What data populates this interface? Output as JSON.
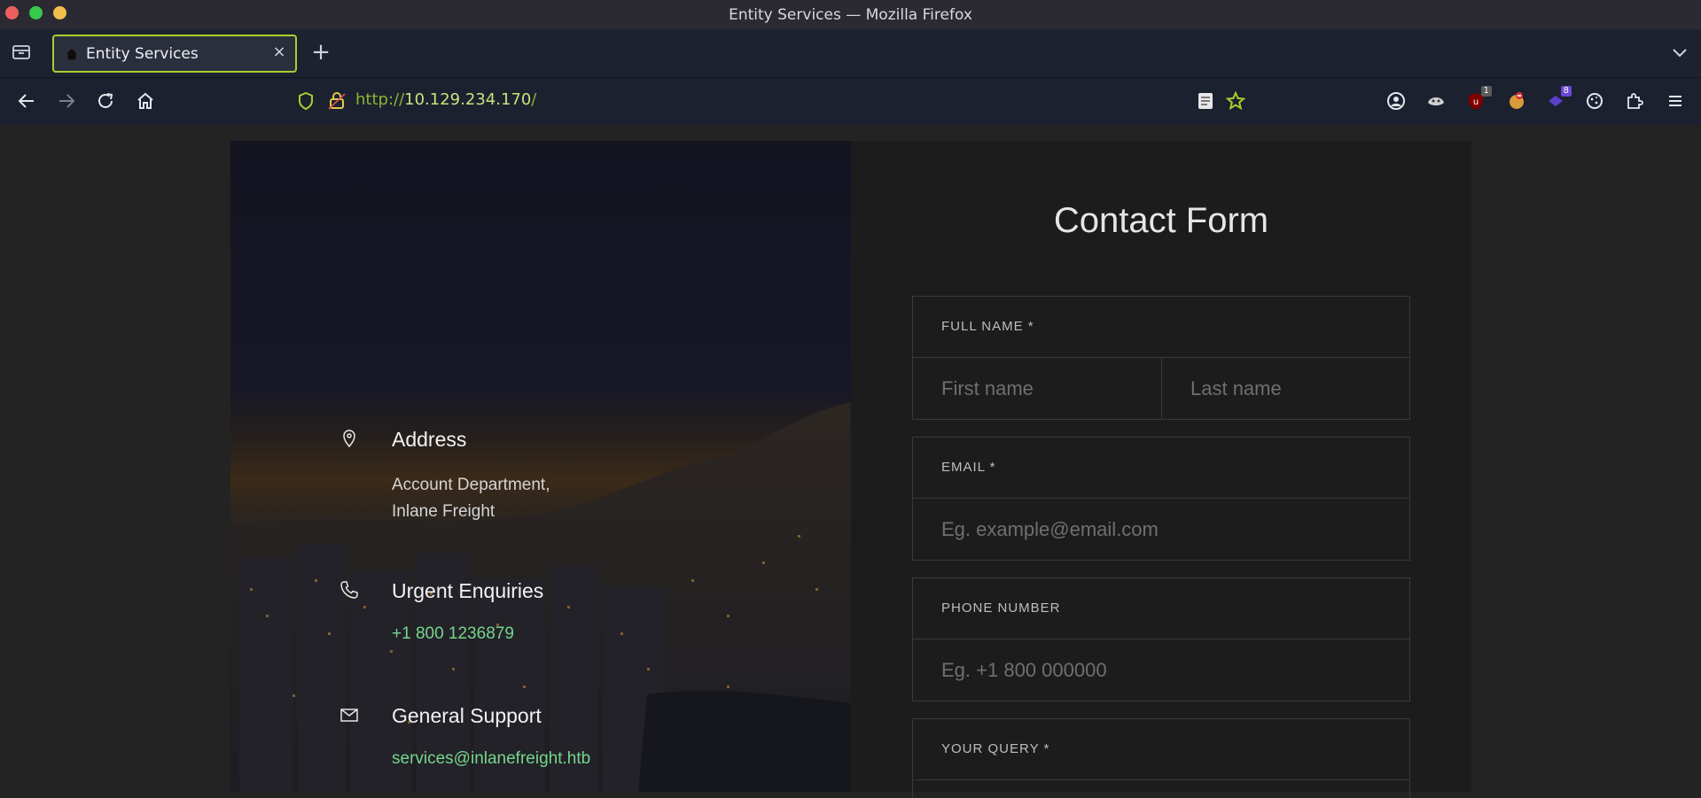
{
  "window": {
    "title": "Entity Services — Mozilla Firefox"
  },
  "tabs": [
    {
      "title": "Entity Services",
      "active": true
    }
  ],
  "navbar": {
    "url_scheme": "http://",
    "url_host": "10.129.234.170",
    "url_path": "/",
    "extension_badges": {
      "ublock": "1",
      "ext_purple": "8"
    }
  },
  "contact_info": {
    "address": {
      "title": "Address",
      "line1": "Account Department,",
      "line2": "Inlane Freight"
    },
    "urgent": {
      "title": "Urgent Enquiries",
      "phone": "+1 800 1236879"
    },
    "support": {
      "title": "General Support",
      "email": "services@inlanefreight.htb"
    }
  },
  "form": {
    "title": "Contact Form",
    "full_name": {
      "label": "FULL NAME *",
      "first_placeholder": "First name",
      "last_placeholder": "Last name"
    },
    "email": {
      "label": "EMAIL *",
      "placeholder": "Eg. example@email.com"
    },
    "phone": {
      "label": "PHONE NUMBER",
      "placeholder": "Eg. +1 800 000000"
    },
    "query": {
      "label": "YOUR QUERY *"
    }
  },
  "colors": {
    "accent": "#a7cf2d",
    "link_green": "#75d68b",
    "url_green": "#8fb332"
  }
}
